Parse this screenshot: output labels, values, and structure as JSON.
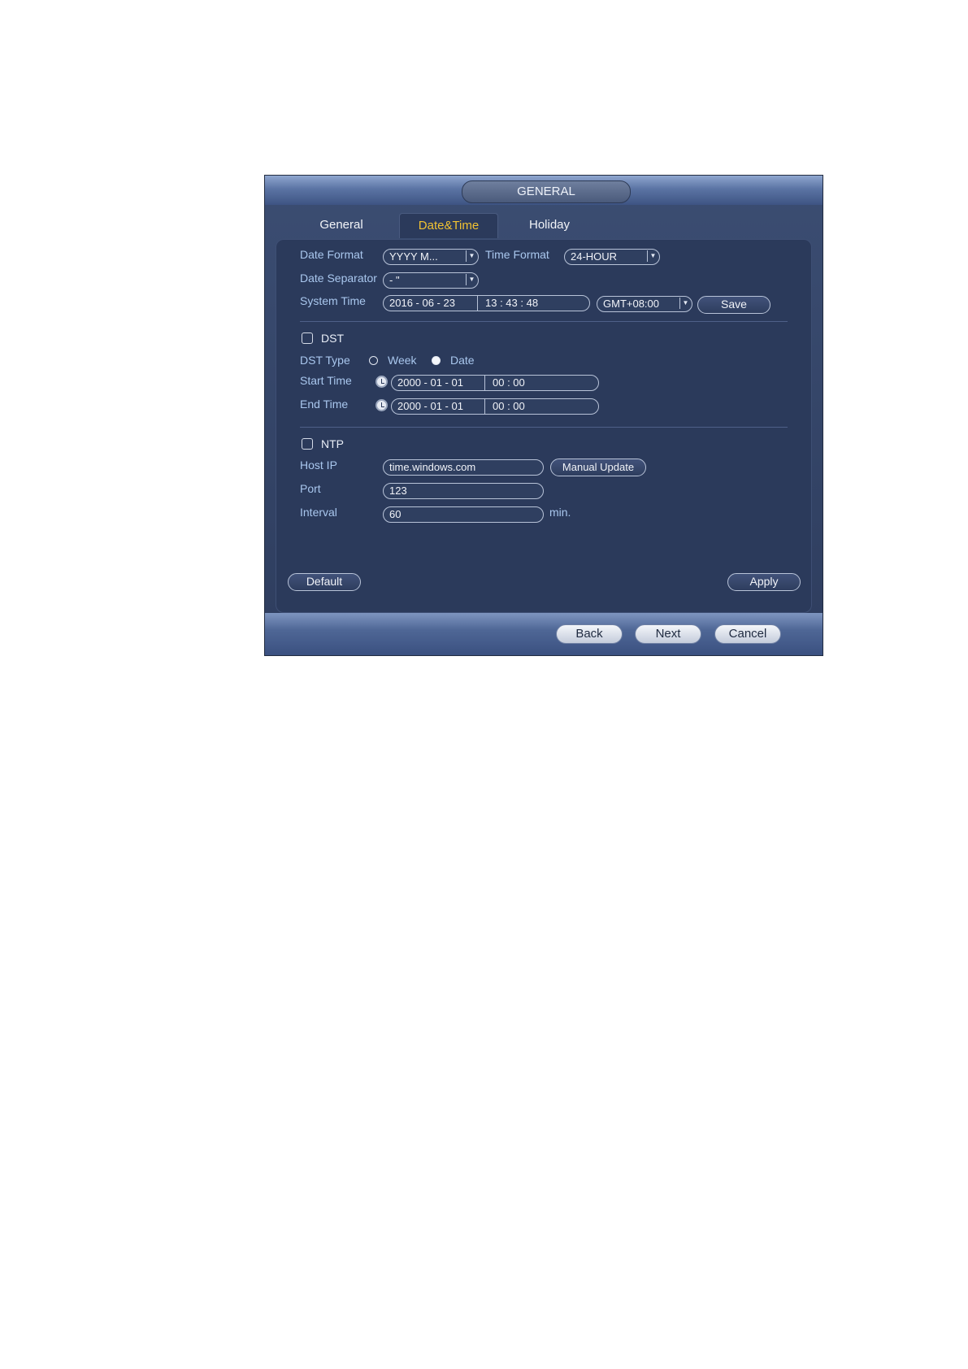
{
  "dialog": {
    "title": "GENERAL",
    "tabs": [
      {
        "label": "General",
        "active": false
      },
      {
        "label": "Date&Time",
        "active": true
      },
      {
        "label": "Holiday",
        "active": false
      }
    ]
  },
  "datetime": {
    "date_format_label": "Date Format",
    "date_format_value": "YYYY M...",
    "time_format_label": "Time Format",
    "time_format_value": "24-HOUR",
    "date_separator_label": "Date Separator",
    "date_separator_value": "-   \"",
    "system_time_label": "System Time",
    "system_date": "2016  - 06 - 23",
    "system_clock": "13 : 43 : 48",
    "timezone_value": "GMT+08:00",
    "save_label": "Save"
  },
  "dst": {
    "checkbox_label": "DST",
    "checked": false,
    "type_label": "DST Type",
    "option_week": "Week",
    "option_date": "Date",
    "selected": "Date",
    "start_label": "Start Time",
    "start_date": "2000  - 01 - 01",
    "start_clock": "00 : 00",
    "end_label": "End Time",
    "end_date": "2000  - 01 - 01",
    "end_clock": "00 : 00"
  },
  "ntp": {
    "checkbox_label": "NTP",
    "checked": false,
    "host_label": "Host IP",
    "host_value": "time.windows.com",
    "manual_update_label": "Manual Update",
    "port_label": "Port",
    "port_value": "123",
    "interval_label": "Interval",
    "interval_value": "60",
    "interval_unit": "min."
  },
  "panel_buttons": {
    "default_label": "Default",
    "apply_label": "Apply"
  },
  "footer": {
    "back_label": "Back",
    "next_label": "Next",
    "cancel_label": "Cancel"
  },
  "colors": {
    "dialog_bg": "#2e3d5e",
    "label_text": "#a9c7ee",
    "active_tab_text": "#f1c232"
  }
}
